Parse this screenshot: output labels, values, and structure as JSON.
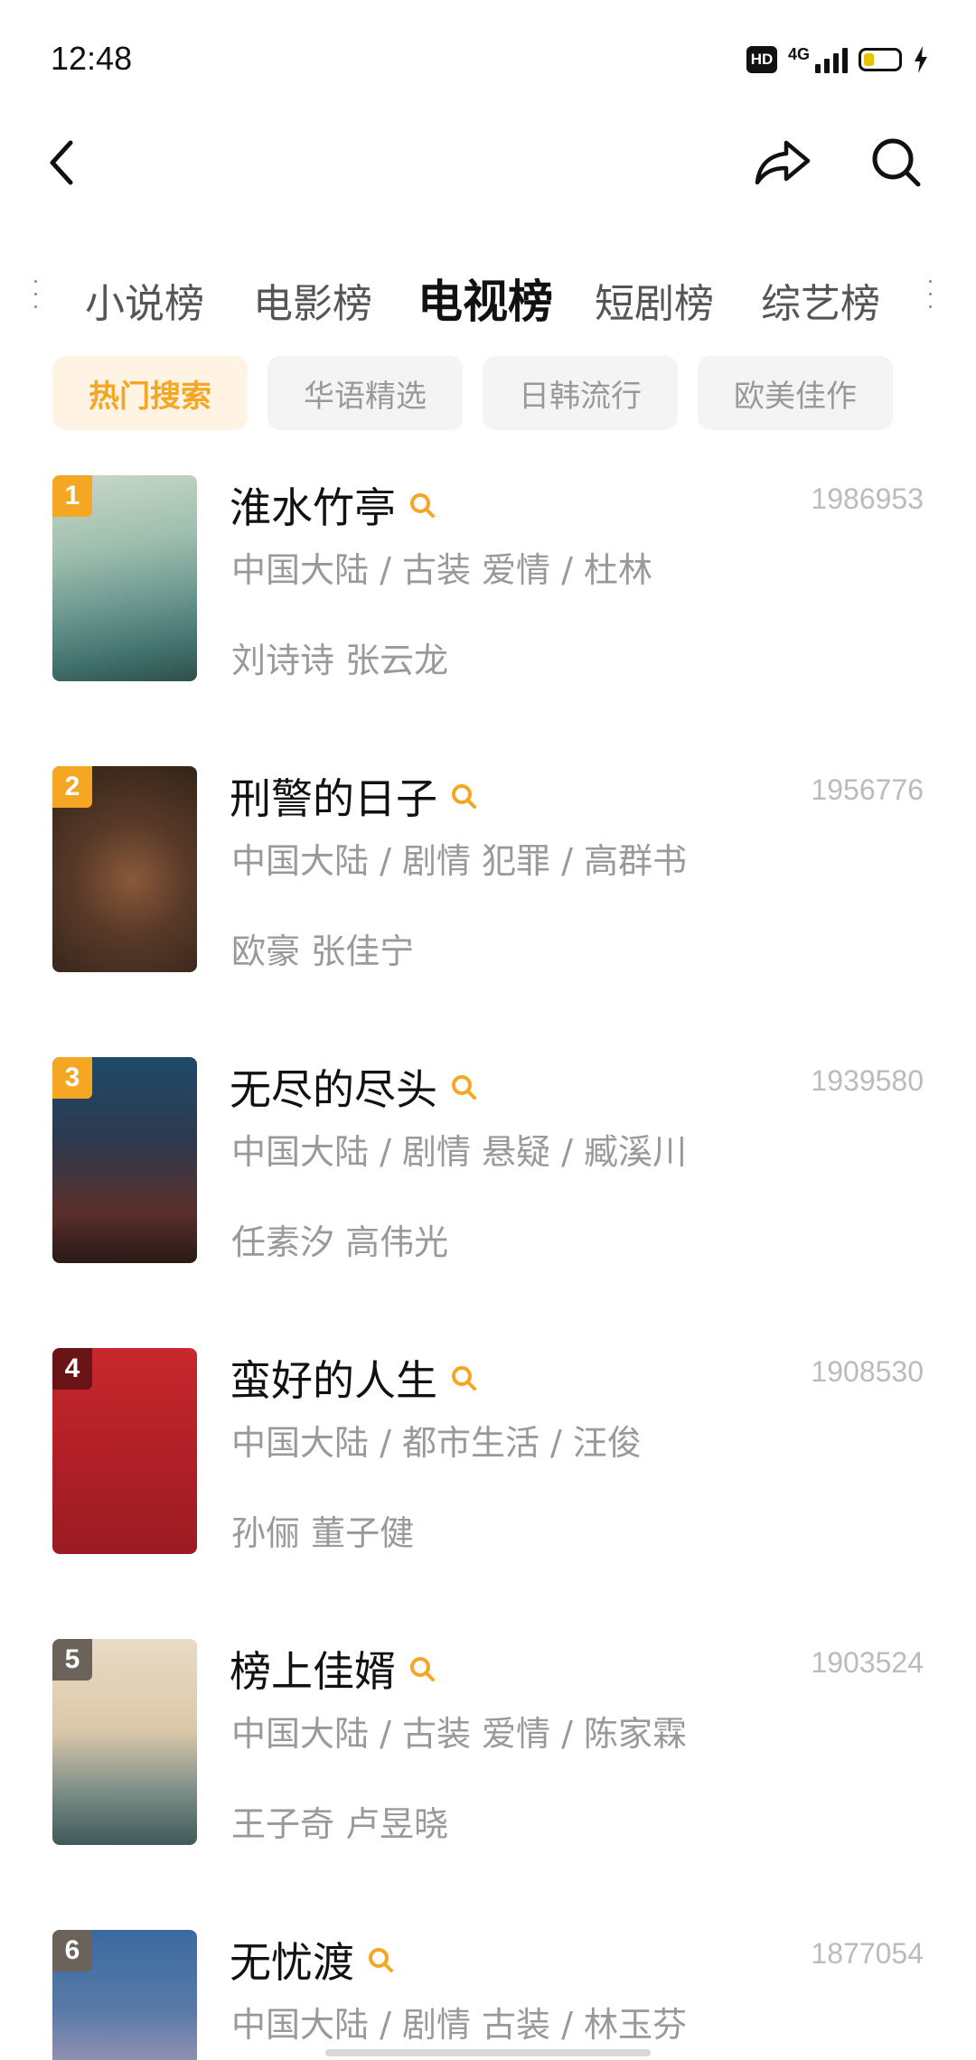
{
  "status_bar": {
    "time": "12:48",
    "hd_label": "HD",
    "network_label": "4G",
    "battery_level": 0.3
  },
  "nav": {
    "back_icon": "chevron-left-icon",
    "share_icon": "share-icon",
    "search_icon": "search-icon"
  },
  "top_tabs": [
    {
      "label": "小说榜",
      "active": false
    },
    {
      "label": "电影榜",
      "active": false
    },
    {
      "label": "电视榜",
      "active": true
    },
    {
      "label": "短剧榜",
      "active": false
    },
    {
      "label": "综艺榜",
      "active": false
    }
  ],
  "chips": [
    {
      "label": "热门搜索",
      "active": true
    },
    {
      "label": "华语精选",
      "active": false
    },
    {
      "label": "日韩流行",
      "active": false
    },
    {
      "label": "欧美佳作",
      "active": false
    }
  ],
  "colors": {
    "accent": "#f5a623",
    "rank_top": "#f5a623",
    "rank_4": "#c0272d",
    "rank_other": "#6b625a"
  },
  "items": [
    {
      "rank": "1",
      "title": "淮水竹亭",
      "score": "1986953",
      "meta": "中国大陆 / 古装 爱情 / 杜林",
      "cast": "刘诗诗 张云龙"
    },
    {
      "rank": "2",
      "title": "刑警的日子",
      "score": "1956776",
      "meta": "中国大陆 / 剧情 犯罪 / 高群书",
      "cast": "欧豪 张佳宁"
    },
    {
      "rank": "3",
      "title": "无尽的尽头",
      "score": "1939580",
      "meta": "中国大陆 / 剧情 悬疑 / 臧溪川",
      "cast": "任素汐 高伟光"
    },
    {
      "rank": "4",
      "title": "蛮好的人生",
      "score": "1908530",
      "meta": "中国大陆 / 都市生活 / 汪俊",
      "cast": "孙俪 董子健"
    },
    {
      "rank": "5",
      "title": "榜上佳婿",
      "score": "1903524",
      "meta": "中国大陆 / 古装 爱情 / 陈家霖",
      "cast": "王子奇 卢昱晓"
    },
    {
      "rank": "6",
      "title": "无忧渡",
      "score": "1877054",
      "meta": "中国大陆 / 剧情 古装 / 林玉芬",
      "cast": ""
    }
  ]
}
